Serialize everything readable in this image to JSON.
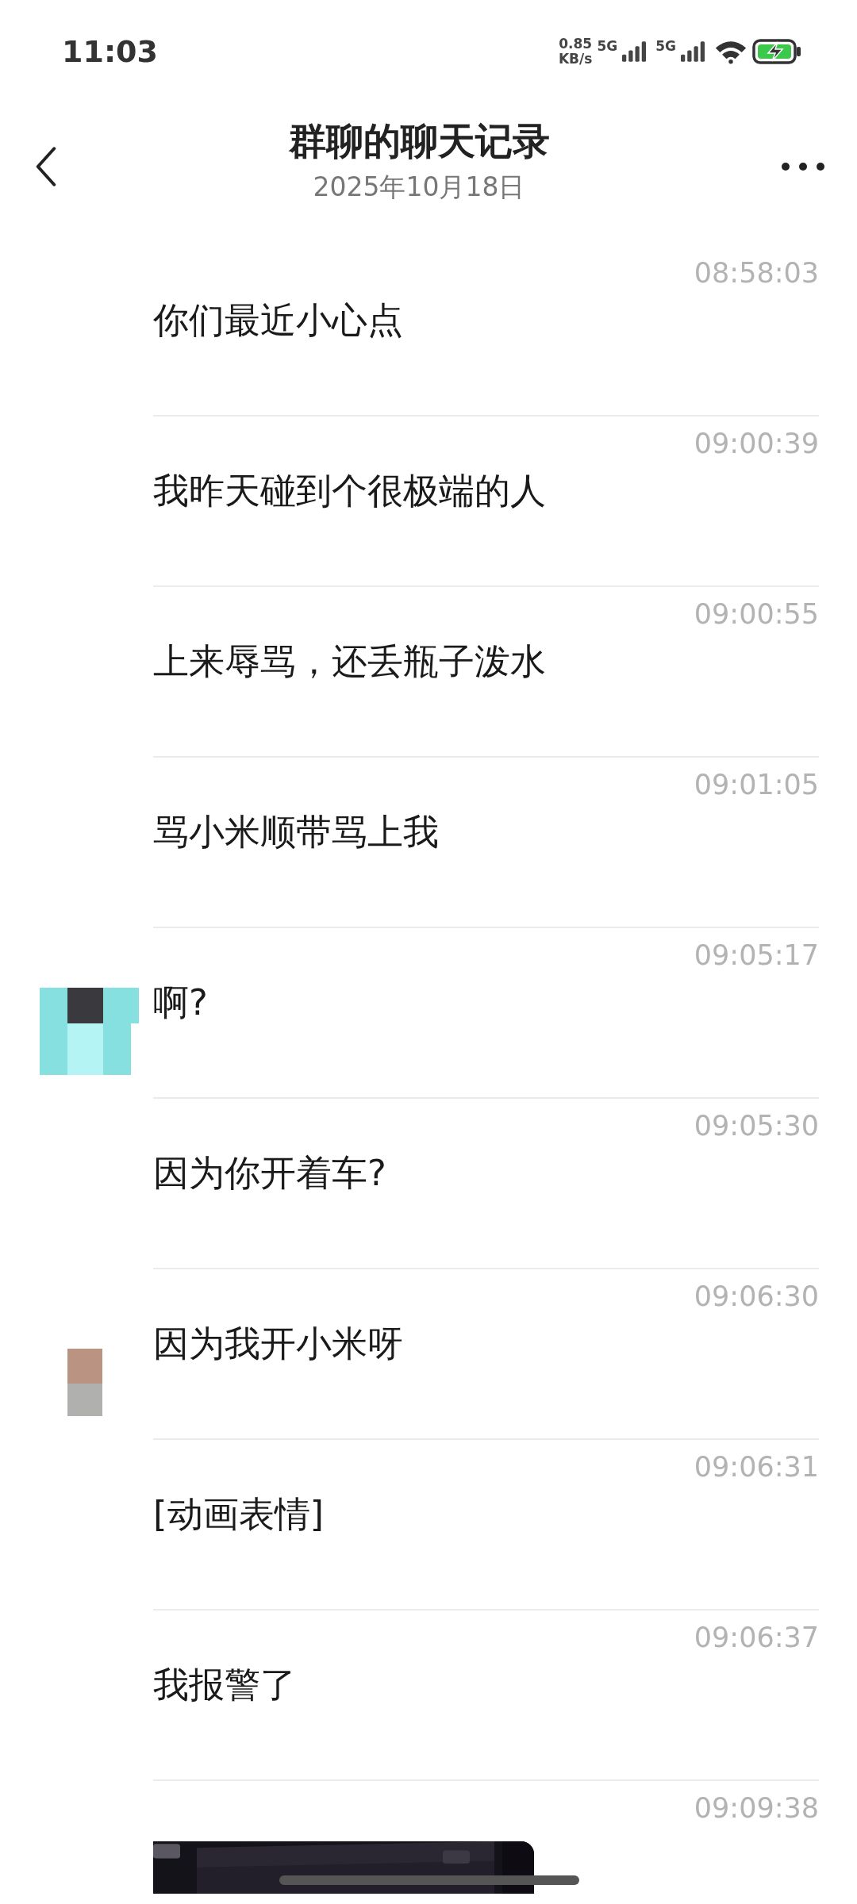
{
  "status_bar": {
    "time": "11:03",
    "net_speed": "0.85",
    "net_unit": "KB/s",
    "sim_1": "5G",
    "sim_2": "5G"
  },
  "header": {
    "title": "群聊的聊天记录",
    "date": "2025年10月18日"
  },
  "messages": [
    {
      "time": "08:58:03",
      "text": "你们最近小心点"
    },
    {
      "time": "09:00:39",
      "text": "我昨天碰到个很极端的人"
    },
    {
      "time": "09:00:55",
      "text": "上来辱骂，还丢瓶子泼水"
    },
    {
      "time": "09:01:05",
      "text": "骂小米顺带骂上我"
    },
    {
      "time": "09:05:17",
      "text": "啊?",
      "kind": "teal"
    },
    {
      "time": "09:05:30",
      "text": "因为你开着车?"
    },
    {
      "time": "09:06:30",
      "text": "因为我开小米呀",
      "kind": "tan"
    },
    {
      "time": "09:06:31",
      "text": "[动画表情]"
    },
    {
      "time": "09:06:37",
      "text": "我报警了"
    },
    {
      "time": "09:09:38",
      "kind": "picture"
    }
  ]
}
